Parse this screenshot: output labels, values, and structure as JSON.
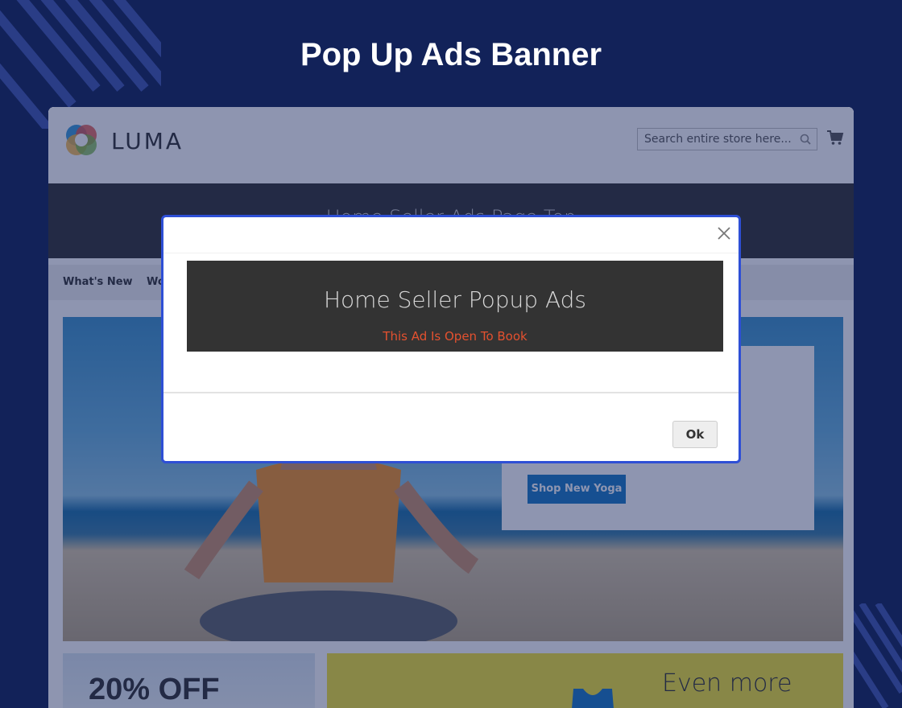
{
  "heading": "Pop Up Ads Banner",
  "store": {
    "logo_text": "LUMA",
    "search": {
      "placeholder": "Search entire store here..."
    },
    "top_banner_text": "Home Seller Ads Page Top",
    "nav": [
      "What's New",
      "Wo"
    ],
    "hero": {
      "button_label": "Shop New Yoga"
    },
    "promo_left": "20% OFF",
    "promo_right": "Even more"
  },
  "modal": {
    "ad_title": "Home Seller Popup Ads",
    "ad_subtitle": "This Ad Is Open To Book",
    "ok_label": "Ok"
  },
  "colors": {
    "background": "#122259",
    "modal_border": "#2e4fd6",
    "ad_box": "#333333",
    "ad_subtitle": "#e4512f",
    "hero_button": "#1979c3"
  }
}
